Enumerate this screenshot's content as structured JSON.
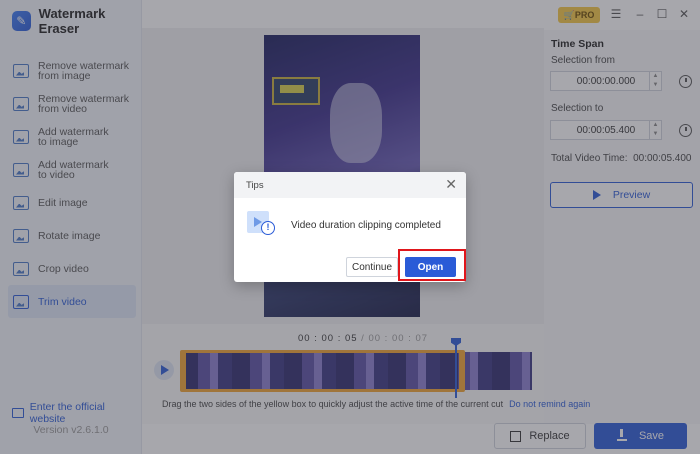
{
  "app": {
    "title": "Watermark Eraser",
    "version": "Version v2.6.1.0"
  },
  "titlebar": {
    "pro_label": "PRO"
  },
  "sidebar": {
    "items": [
      {
        "line1": "Remove watermark",
        "line2": "from image"
      },
      {
        "line1": "Remove watermark",
        "line2": "from video"
      },
      {
        "line1": "Add watermark",
        "line2": "to image"
      },
      {
        "line1": "Add watermark",
        "line2": "to video"
      },
      {
        "line1": "Edit image",
        "line2": ""
      },
      {
        "line1": "Rotate image",
        "line2": ""
      },
      {
        "line1": "Crop video",
        "line2": ""
      },
      {
        "line1": "Trim video",
        "line2": ""
      }
    ],
    "active_index": 7,
    "official_link": "Enter the official website"
  },
  "panel": {
    "section_title": "Time Span",
    "from_label": "Selection from",
    "from_value": "00:00:00.000",
    "to_label": "Selection to",
    "to_value": "00:00:05.400",
    "total_label": "Total Video Time:",
    "total_value": "00:00:05.400",
    "preview_label": "Preview"
  },
  "timeline": {
    "current": "00 : 00 : 05",
    "separator": " / ",
    "total": "00 : 00 : 07",
    "hint": "Drag the two sides of the yellow box to quickly adjust the active time of the current cut",
    "dont_remind": "Do not remind again"
  },
  "actions": {
    "replace_label": "Replace",
    "save_label": "Save"
  },
  "dialog": {
    "title": "Tips",
    "message": "Video duration clipping completed",
    "continue_label": "Continue",
    "open_label": "Open"
  },
  "colors": {
    "accent": "#2a5bd7",
    "highlight": "#e0161b",
    "selection": "#f2a532",
    "pro": "#f6c844"
  }
}
